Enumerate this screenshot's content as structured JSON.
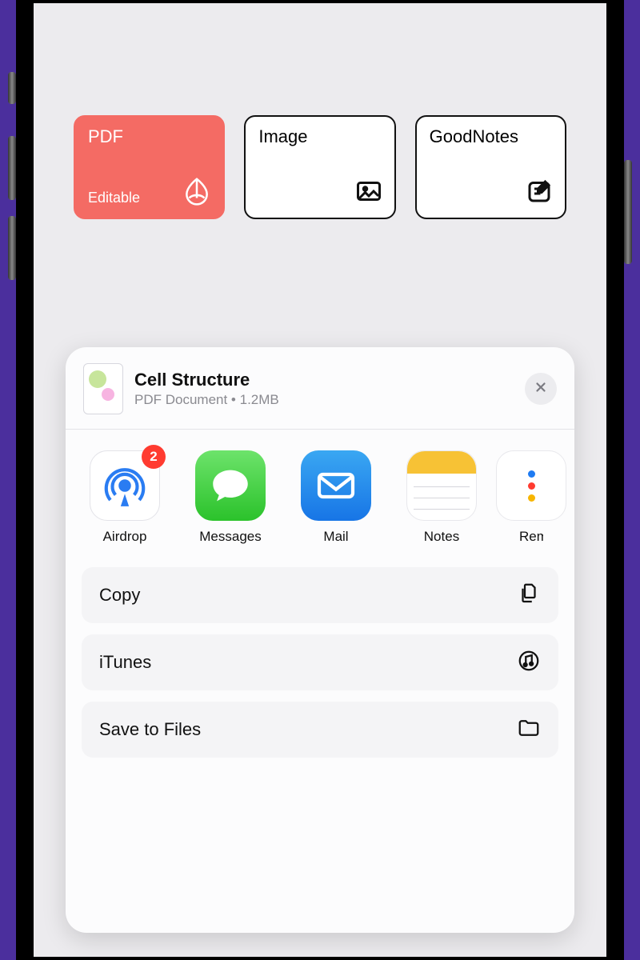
{
  "formats": [
    {
      "title": "PDF",
      "subtitle": "Editable",
      "icon": "pdf-icon",
      "selected": true
    },
    {
      "title": "Image",
      "subtitle": "",
      "icon": "image-icon",
      "selected": false
    },
    {
      "title": "GoodNotes",
      "subtitle": "",
      "icon": "notebook-icon",
      "selected": false
    }
  ],
  "file": {
    "title": "Cell Structure",
    "type": "PDF Document",
    "sep": " • ",
    "size": "1.2MB"
  },
  "apps": [
    {
      "label": "Airdrop",
      "badge": "2",
      "icon": "airdrop-icon"
    },
    {
      "label": "Messages",
      "badge": "",
      "icon": "messages-icon"
    },
    {
      "label": "Mail",
      "badge": "",
      "icon": "mail-icon"
    },
    {
      "label": "Notes",
      "badge": "",
      "icon": "notes-icon"
    },
    {
      "label": "Reminders",
      "badge": "",
      "icon": "reminders-icon"
    }
  ],
  "actions": [
    {
      "label": "Copy",
      "icon": "copy-icon"
    },
    {
      "label": "iTunes",
      "icon": "itunes-icon"
    },
    {
      "label": "Save to Files",
      "icon": "folder-icon"
    }
  ]
}
